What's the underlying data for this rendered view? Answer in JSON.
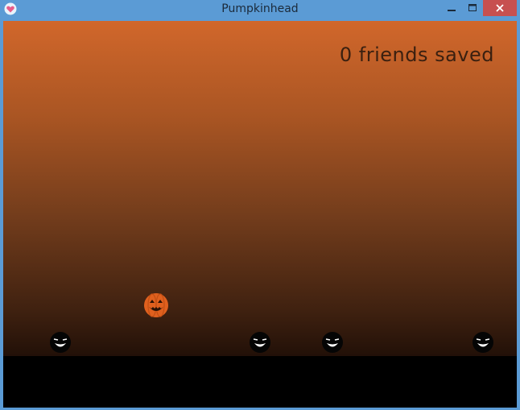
{
  "window": {
    "title": "Pumpkinhead",
    "icon": "heart-app-icon",
    "controls": {
      "minimize": "minimize-icon",
      "maximize": "maximize-icon",
      "close": "close-icon"
    }
  },
  "game": {
    "score_text": "0 friends saved",
    "colors": {
      "sky_top": "#d1672b",
      "sky_bottom": "#120703",
      "ground": "#000000",
      "pumpkin": "#e0601e",
      "score": "#3a2010"
    },
    "player": "pumpkin-player",
    "enemies": [
      "shadow-creature",
      "shadow-creature",
      "shadow-creature",
      "shadow-creature"
    ]
  }
}
